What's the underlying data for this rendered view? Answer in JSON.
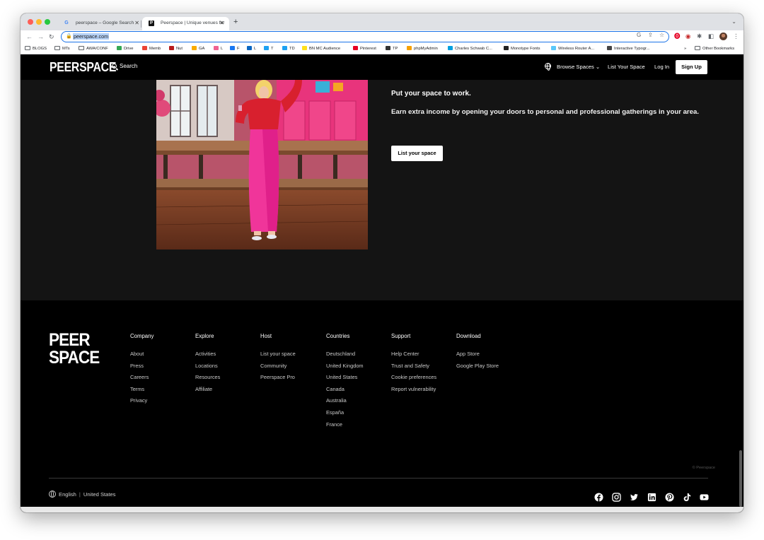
{
  "browser": {
    "tabs": [
      {
        "title": "peerspace – Google Search",
        "favicon": "G"
      },
      {
        "title": "Peerspace | Unique venues for",
        "favicon": "P"
      }
    ],
    "url": "peerspace.com",
    "new_tab": "+",
    "bookmarks": [
      {
        "label": "BLOGS",
        "icon": "folder",
        "color": ""
      },
      {
        "label": "MTs",
        "icon": "folder",
        "color": ""
      },
      {
        "label": "AWA/CONF",
        "icon": "folder",
        "color": ""
      },
      {
        "label": "Drive",
        "icon": "drive",
        "color": "#34a853"
      },
      {
        "label": "Memb",
        "icon": "memb",
        "color": "#ea4335"
      },
      {
        "label": "Nut",
        "icon": "nut",
        "color": "#b71c1c"
      },
      {
        "label": "GA",
        "icon": "ga",
        "color": "#f9ab00"
      },
      {
        "label": "L",
        "icon": "l",
        "color": "#f06292"
      },
      {
        "label": "F",
        "icon": "facebook",
        "color": "#1877f2"
      },
      {
        "label": "L",
        "icon": "linkedin",
        "color": "#0a66c2"
      },
      {
        "label": "T",
        "icon": "twitter",
        "color": "#1da1f2"
      },
      {
        "label": "TD",
        "icon": "td",
        "color": "#1da1f2"
      },
      {
        "label": "BN MC Audience",
        "icon": "mc",
        "color": "#ffe01b"
      },
      {
        "label": "Pinterest",
        "icon": "pinterest",
        "color": "#e60023"
      },
      {
        "label": "TP",
        "icon": "tp",
        "color": "#333"
      },
      {
        "label": "phpMyAdmin",
        "icon": "pma",
        "color": "#f6a000"
      },
      {
        "label": "Charles Schwab C...",
        "icon": "schwab",
        "color": "#00a0df"
      },
      {
        "label": "Monotype Fonts",
        "icon": "monotype",
        "color": "#222"
      },
      {
        "label": "Wireless Router A...",
        "icon": "router",
        "color": "#5ac8fa"
      },
      {
        "label": "Interactive Typogr...",
        "icon": "typo",
        "color": "#444"
      }
    ],
    "bookmarks_overflow": "»",
    "other_bookmarks": "Other Bookmarks"
  },
  "header": {
    "logo": "PEERSPACE",
    "search": "Search",
    "browse": "Browse Spaces",
    "list_space": "List Your Space",
    "login": "Log In",
    "signup": "Sign Up"
  },
  "hero": {
    "title": "Put your space to work.",
    "subtitle": "Earn extra income by opening your doors to personal and professional gatherings in your area.",
    "button": "List your space"
  },
  "footer": {
    "logo_lines": [
      "PEER",
      "SPACE"
    ],
    "columns": [
      {
        "heading": "Company",
        "links": [
          "About",
          "Press",
          "Careers",
          "Terms",
          "Privacy"
        ]
      },
      {
        "heading": "Explore",
        "links": [
          "Activities",
          "Locations",
          "Resources",
          "Affiliate"
        ]
      },
      {
        "heading": "Host",
        "links": [
          "List your space",
          "Community",
          "Peerspace Pro"
        ]
      },
      {
        "heading": "Countries",
        "links": [
          "Deutschland",
          "United Kingdom",
          "United States",
          "Canada",
          "Australia",
          "España",
          "France"
        ]
      },
      {
        "heading": "Support",
        "links": [
          "Help Center",
          "Trust and Safety",
          "Cookie preferences",
          "Report vulnerability"
        ]
      },
      {
        "heading": "Download",
        "links": [
          "App Store",
          "Google Play Store"
        ]
      }
    ],
    "copyright": "© Peerspace",
    "language": "English",
    "region": "United States",
    "social": [
      "facebook",
      "instagram",
      "twitter",
      "linkedin",
      "pinterest",
      "tiktok",
      "youtube"
    ]
  }
}
